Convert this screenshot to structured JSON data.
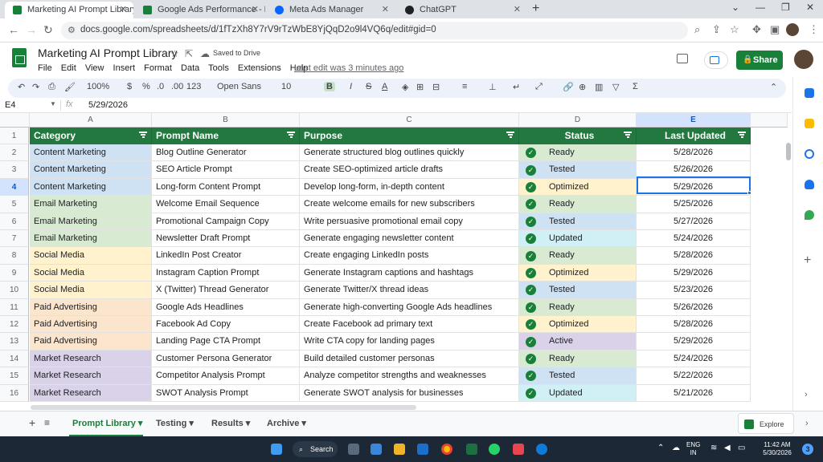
{
  "browser": {
    "tabs": [
      {
        "title": "Marketing AI Prompt Library - G",
        "color": "#188038",
        "active": true
      },
      {
        "title": "Google Ads Performance - May 2",
        "color": "#188038",
        "active": false
      },
      {
        "title": "Meta Ads Manager",
        "color": "#0866ff",
        "active": false
      },
      {
        "title": "ChatGPT",
        "color": "#202124",
        "active": false
      }
    ],
    "url": "docs.google.com/spreadsheets/d/1fTzXh8Y7rV9rTzWbE8YjQqD2o9l4VQ6q/edit#gid=0"
  },
  "doc": {
    "title": "Marketing AI Prompt Library",
    "saved": "Saved to Drive",
    "last_edit": "Last edit was 3 minutes ago",
    "share_label": "Share",
    "menu": [
      "File",
      "Edit",
      "View",
      "Insert",
      "Format",
      "Data",
      "Tools",
      "Extensions",
      "Help"
    ]
  },
  "toolbar": {
    "zoom": "100%",
    "currency": "$",
    "percent": "%",
    "dec_less": ".0",
    "dec_more": ".00",
    "format123": "123",
    "font": "Open Sans",
    "font_size": "10",
    "bold": "B",
    "italic": "I",
    "strike": "S",
    "textcolor": "A"
  },
  "formula_bar": {
    "cell": "E4",
    "fx": "fx",
    "value": "5/29/2026"
  },
  "columns": [
    "A",
    "B",
    "C",
    "D",
    "E"
  ],
  "header": [
    "Category",
    "Prompt Name",
    "Purpose",
    "Status",
    "Last Updated"
  ],
  "category_colors": {
    "Content Marketing": "#cfe2f3",
    "Email Marketing": "#d9ead3",
    "Social Media": "#fff2cc",
    "Paid Advertising": "#fce5cd",
    "Market Research": "#d9d2e9"
  },
  "status_colors": {
    "Ready": "#d9ead3",
    "Tested": "#cfe2f3",
    "Optimized": "#fff2cc",
    "Updated": "#d0f0f5",
    "Active": "#d9d2e9"
  },
  "rows": [
    {
      "n": "2",
      "category": "Content Marketing",
      "prompt": "Blog Outline Generator",
      "purpose": "Generate structured blog outlines quickly",
      "status": "Ready",
      "date": "5/28/2026"
    },
    {
      "n": "3",
      "category": "Content Marketing",
      "prompt": "SEO Article Prompt",
      "purpose": "Create SEO-optimized article drafts",
      "status": "Tested",
      "date": "5/26/2026"
    },
    {
      "n": "4",
      "category": "Content Marketing",
      "prompt": "Long-form Content Prompt",
      "purpose": "Develop long-form, in-depth content",
      "status": "Optimized",
      "date": "5/29/2026"
    },
    {
      "n": "5",
      "category": "Email Marketing",
      "prompt": "Welcome Email Sequence",
      "purpose": "Create welcome emails for new subscribers",
      "status": "Ready",
      "date": "5/25/2026"
    },
    {
      "n": "6",
      "category": "Email Marketing",
      "prompt": "Promotional Campaign Copy",
      "purpose": "Write persuasive promotional email copy",
      "status": "Tested",
      "date": "5/27/2026"
    },
    {
      "n": "7",
      "category": "Email Marketing",
      "prompt": "Newsletter Draft Prompt",
      "purpose": "Generate engaging newsletter content",
      "status": "Updated",
      "date": "5/24/2026"
    },
    {
      "n": "8",
      "category": "Social Media",
      "prompt": "LinkedIn Post Creator",
      "purpose": "Create engaging LinkedIn posts",
      "status": "Ready",
      "date": "5/28/2026"
    },
    {
      "n": "9",
      "category": "Social Media",
      "prompt": "Instagram Caption Prompt",
      "purpose": "Generate Instagram captions and hashtags",
      "status": "Optimized",
      "date": "5/29/2026"
    },
    {
      "n": "10",
      "category": "Social Media",
      "prompt": "X (Twitter) Thread Generator",
      "purpose": "Generate Twitter/X thread ideas",
      "status": "Tested",
      "date": "5/23/2026"
    },
    {
      "n": "11",
      "category": "Paid Advertising",
      "prompt": "Google Ads Headlines",
      "purpose": "Generate high-converting Google Ads headlines",
      "status": "Ready",
      "date": "5/26/2026"
    },
    {
      "n": "12",
      "category": "Paid Advertising",
      "prompt": "Facebook Ad Copy",
      "purpose": "Create Facebook ad primary text",
      "status": "Optimized",
      "date": "5/28/2026"
    },
    {
      "n": "13",
      "category": "Paid Advertising",
      "prompt": "Landing Page CTA Prompt",
      "purpose": "Write CTA copy for landing pages",
      "status": "Active",
      "date": "5/29/2026"
    },
    {
      "n": "14",
      "category": "Market Research",
      "prompt": "Customer Persona Generator",
      "purpose": "Build detailed customer personas",
      "status": "Ready",
      "date": "5/24/2026"
    },
    {
      "n": "15",
      "category": "Market Research",
      "prompt": "Competitor Analysis Prompt",
      "purpose": "Analyze competitor strengths and weaknesses",
      "status": "Tested",
      "date": "5/22/2026"
    },
    {
      "n": "16",
      "category": "Market Research",
      "prompt": "SWOT Analysis Prompt",
      "purpose": "Generate SWOT analysis for businesses",
      "status": "Updated",
      "date": "5/21/2026"
    }
  ],
  "sheets": [
    "Prompt Library",
    "Testing",
    "Results",
    "Archive"
  ],
  "explore_label": "Explore",
  "taskbar": {
    "search": "Search",
    "lang1": "ENG",
    "lang2": "IN",
    "time": "11:42 AM",
    "date": "5/30/2026",
    "badge": "3"
  }
}
